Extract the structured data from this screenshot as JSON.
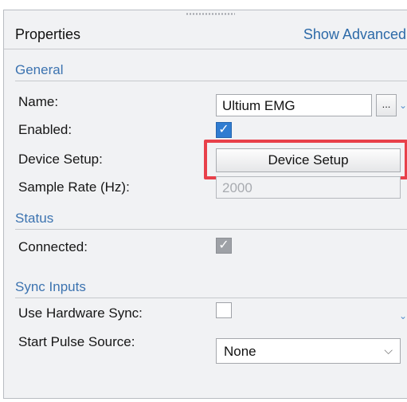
{
  "header": {
    "title": "Properties",
    "show_advanced": "Show Advanced"
  },
  "general": {
    "section_label": "General",
    "name": {
      "label": "Name:",
      "value": "Ultium EMG",
      "ellipsis": "...",
      "expand_icon": "chevron-down-icon"
    },
    "enabled": {
      "label": "Enabled:",
      "checked": true,
      "glyph": "✓"
    },
    "device_setup": {
      "label": "Device Setup:",
      "button_label": "Device Setup"
    },
    "sample_rate": {
      "label": "Sample Rate (Hz):",
      "value": "2000"
    }
  },
  "status": {
    "section_label": "Status",
    "connected": {
      "label": "Connected:",
      "checked": true,
      "glyph": "✓"
    }
  },
  "sync_inputs": {
    "section_label": "Sync Inputs",
    "use_hardware_sync": {
      "label": "Use Hardware Sync:",
      "checked": false
    },
    "start_pulse_source": {
      "label": "Start Pulse Source:",
      "value": "None",
      "arrow_icon": "chevron-down-icon"
    }
  },
  "colors": {
    "section": "#3c73b0",
    "accent": "#2f7cd1",
    "highlight": "#e8404a"
  }
}
